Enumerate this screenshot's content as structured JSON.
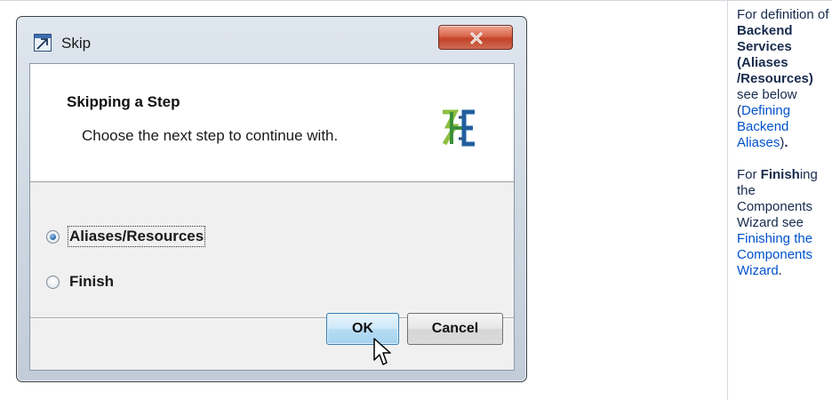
{
  "dialog": {
    "title": "Skip",
    "step_title": "Skipping a Step",
    "step_description": "Choose the next step to continue with.",
    "options": [
      {
        "label": "Aliases/Resources",
        "selected": true
      },
      {
        "label": "Finish",
        "selected": false
      }
    ],
    "ok_label": "OK",
    "cancel_label": "Cancel"
  },
  "side_notes": {
    "p1_prefix": "For definition of",
    "p1_bold": "Backend Services (Aliases /Resources)",
    "p1_mid": "see below (",
    "p1_link": "Defining Backend Aliases",
    "p1_suffix": ")",
    "p1_period": ".",
    "p2_bold": "Finish",
    "p2_after_bold": "ing the Components Wizard see",
    "p2_link": "Finishing the Components Wizard",
    "p2_suffix": "."
  },
  "colors": {
    "link": "#0052cc",
    "close_button": "#c2432a",
    "ok_button": "#b6dcf4"
  }
}
